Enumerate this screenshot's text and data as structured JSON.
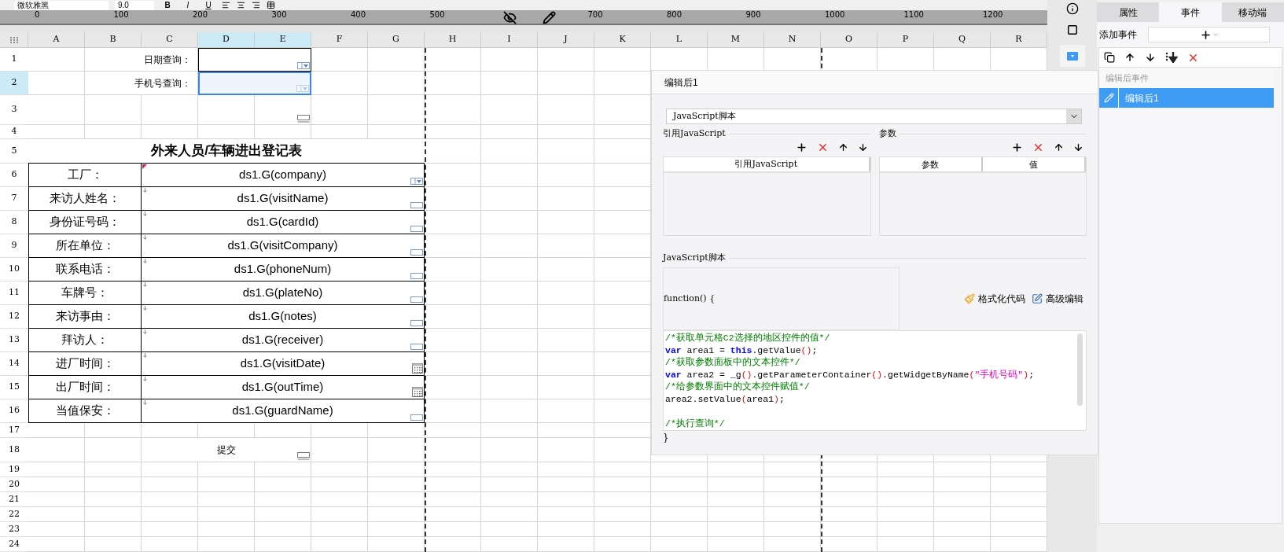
{
  "toolbar": {
    "font": "微软雅黑",
    "size": "9.0",
    "styles": [
      {
        "kind": "bold",
        "label": "B"
      },
      {
        "kind": "italic",
        "label": "I"
      },
      {
        "kind": "underline",
        "label": "U"
      }
    ]
  },
  "ruler": {
    "labels": [
      "0",
      "100",
      "200",
      "300",
      "400",
      "500",
      "700",
      "800",
      "900",
      "1000",
      "1100",
      "1200"
    ]
  },
  "sheet": {
    "columns": [
      {
        "label": "A",
        "selected": false
      },
      {
        "label": "B",
        "selected": false
      },
      {
        "label": "C",
        "selected": false
      },
      {
        "label": "D",
        "selected": true
      },
      {
        "label": "E",
        "selected": true
      },
      {
        "label": "F",
        "selected": false
      },
      {
        "label": "G",
        "selected": false
      },
      {
        "label": "H",
        "selected": false
      },
      {
        "label": "I",
        "selected": false
      },
      {
        "label": "J",
        "selected": false
      },
      {
        "label": "K",
        "selected": false
      },
      {
        "label": "L",
        "selected": false
      },
      {
        "label": "M",
        "selected": false
      },
      {
        "label": "N",
        "selected": false
      },
      {
        "label": "O",
        "selected": false
      },
      {
        "label": "P",
        "selected": false
      },
      {
        "label": "Q",
        "selected": false
      },
      {
        "label": "R",
        "selected": false
      }
    ],
    "rows": [
      {
        "label": "1",
        "selected": false
      },
      {
        "label": "2",
        "selected": true
      },
      {
        "label": "3",
        "selected": false
      },
      {
        "label": "4",
        "selected": false
      },
      {
        "label": "5",
        "selected": false
      },
      {
        "label": "6",
        "selected": false
      },
      {
        "label": "7",
        "selected": false
      },
      {
        "label": "8",
        "selected": false
      },
      {
        "label": "9",
        "selected": false
      },
      {
        "label": "10",
        "selected": false
      },
      {
        "label": "11",
        "selected": false
      },
      {
        "label": "12",
        "selected": false
      },
      {
        "label": "13",
        "selected": false
      },
      {
        "label": "14",
        "selected": false
      },
      {
        "label": "15",
        "selected": false
      },
      {
        "label": "16",
        "selected": false
      },
      {
        "label": "17",
        "selected": false
      },
      {
        "label": "18",
        "selected": false
      },
      {
        "label": "19",
        "selected": false
      },
      {
        "label": "20",
        "selected": false
      },
      {
        "label": "21",
        "selected": false
      },
      {
        "label": "22",
        "selected": false
      },
      {
        "label": "23",
        "selected": false
      },
      {
        "label": "24",
        "selected": false
      }
    ],
    "query_fields": [
      {
        "label": "日期查询：",
        "selected": false,
        "widget": {
          "kind": "dropdown"
        }
      },
      {
        "label": "手机号查询：",
        "selected": true,
        "widget": {
          "kind": "dropdown"
        }
      }
    ],
    "button_cell": {
      "widget": {
        "kind": "button"
      }
    },
    "form_title": "外来人员/车辆进出登记表",
    "form_rows": [
      {
        "label": "工厂：",
        "value": "ds1.G(company)",
        "widget": {
          "kind": "dropdown"
        },
        "marker": {
          "kind": "flag"
        }
      },
      {
        "label": "来访人姓名：",
        "value": "ds1.G(visitName)",
        "widget": {
          "kind": "text"
        },
        "marker": {
          "kind": "arrow"
        }
      },
      {
        "label": "身份证号码：",
        "value": "ds1.G(cardId)",
        "widget": {
          "kind": "text"
        },
        "marker": {
          "kind": "arrow"
        }
      },
      {
        "label": "所在单位：",
        "value": "ds1.G(visitCompany)",
        "widget": {
          "kind": "text"
        },
        "marker": {
          "kind": "arrow"
        }
      },
      {
        "label": "联系电话：",
        "value": "ds1.G(phoneNum)",
        "widget": {
          "kind": "text"
        },
        "marker": {
          "kind": "arrow"
        }
      },
      {
        "label": "车牌号：",
        "value": "ds1.G(plateNo)",
        "widget": {
          "kind": "text"
        },
        "marker": {
          "kind": "arrow"
        }
      },
      {
        "label": "来访事由：",
        "value": "ds1.G(notes)",
        "widget": {
          "kind": "text"
        },
        "marker": {
          "kind": "arrow"
        }
      },
      {
        "label": "拜访人：",
        "value": "ds1.G(receiver)",
        "widget": {
          "kind": "text"
        },
        "marker": {
          "kind": "arrow"
        }
      },
      {
        "label": "进厂时间：",
        "value": "ds1.G(visitDate)",
        "widget": {
          "kind": "date"
        },
        "marker": {
          "kind": "arrow"
        }
      },
      {
        "label": "出厂时间：",
        "value": "ds1.G(outTime)",
        "widget": {
          "kind": "date"
        },
        "marker": {
          "kind": "arrow"
        }
      },
      {
        "label": "当值保安：",
        "value": "ds1.G(guardName)",
        "widget": {
          "kind": "text"
        },
        "marker": {
          "kind": "arrow"
        }
      }
    ],
    "submit": {
      "label": "提交",
      "widget": {
        "kind": "button"
      }
    }
  },
  "dialog": {
    "title": "编辑后1",
    "type_select": "JavaScript脚本",
    "ref_section": {
      "title": "引用JavaScript",
      "columns": [
        "引用JavaScript"
      ]
    },
    "param_section": {
      "title": "参数",
      "columns": [
        "参数",
        "值"
      ]
    },
    "script_section": {
      "title": "JavaScript脚本",
      "signature": "function() {",
      "format_button": "格式化代码",
      "advanced_button": "高级编辑",
      "closing": "}",
      "lines": [
        {
          "kind": "code",
          "tokens": [
            {
              "kind": "comment",
              "text": "/*获取单元格C2选择的地区控件的值*/"
            }
          ]
        },
        {
          "kind": "code",
          "tokens": [
            {
              "kind": "keyword",
              "text": "var"
            },
            {
              "kind": "plain",
              "text": " area1 = "
            },
            {
              "kind": "keyword",
              "text": "this"
            },
            {
              "kind": "plain",
              "text": ".getValue"
            },
            {
              "kind": "paren",
              "text": "()"
            },
            {
              "kind": "plain",
              "text": ";"
            }
          ]
        },
        {
          "kind": "code",
          "tokens": [
            {
              "kind": "comment",
              "text": "/*获取参数面板中的文本控件*/"
            }
          ]
        },
        {
          "kind": "code",
          "tokens": [
            {
              "kind": "keyword",
              "text": "var"
            },
            {
              "kind": "plain",
              "text": " area2 = _g"
            },
            {
              "kind": "paren",
              "text": "()"
            },
            {
              "kind": "plain",
              "text": ".getParameterContainer"
            },
            {
              "kind": "paren",
              "text": "()"
            },
            {
              "kind": "plain",
              "text": ".getWidgetByName"
            },
            {
              "kind": "paren",
              "text": "("
            },
            {
              "kind": "string",
              "text": "\"手机号码\""
            },
            {
              "kind": "paren",
              "text": ")"
            },
            {
              "kind": "plain",
              "text": ";"
            }
          ]
        },
        {
          "kind": "code",
          "tokens": [
            {
              "kind": "comment",
              "text": "/*给参数界面中的文本控件赋值*/"
            }
          ]
        },
        {
          "kind": "code",
          "tokens": [
            {
              "kind": "plain",
              "text": "area2.setValue"
            },
            {
              "kind": "paren",
              "text": "("
            },
            {
              "kind": "plain",
              "text": "area1"
            },
            {
              "kind": "paren",
              "text": ")"
            },
            {
              "kind": "plain",
              "text": ";"
            }
          ]
        },
        {
          "kind": "blank"
        },
        {
          "kind": "code",
          "tokens": [
            {
              "kind": "comment",
              "text": "/*执行查询*/"
            }
          ]
        }
      ]
    }
  },
  "right_panel": {
    "tabs": [
      {
        "label": "属性",
        "selected": false
      },
      {
        "label": "事件",
        "selected": true
      },
      {
        "label": "移动端",
        "selected": false
      }
    ],
    "add_event_label": "添加事件",
    "event_group": "编辑后事件",
    "events": [
      {
        "label": "编辑后1",
        "selected": true
      }
    ]
  }
}
